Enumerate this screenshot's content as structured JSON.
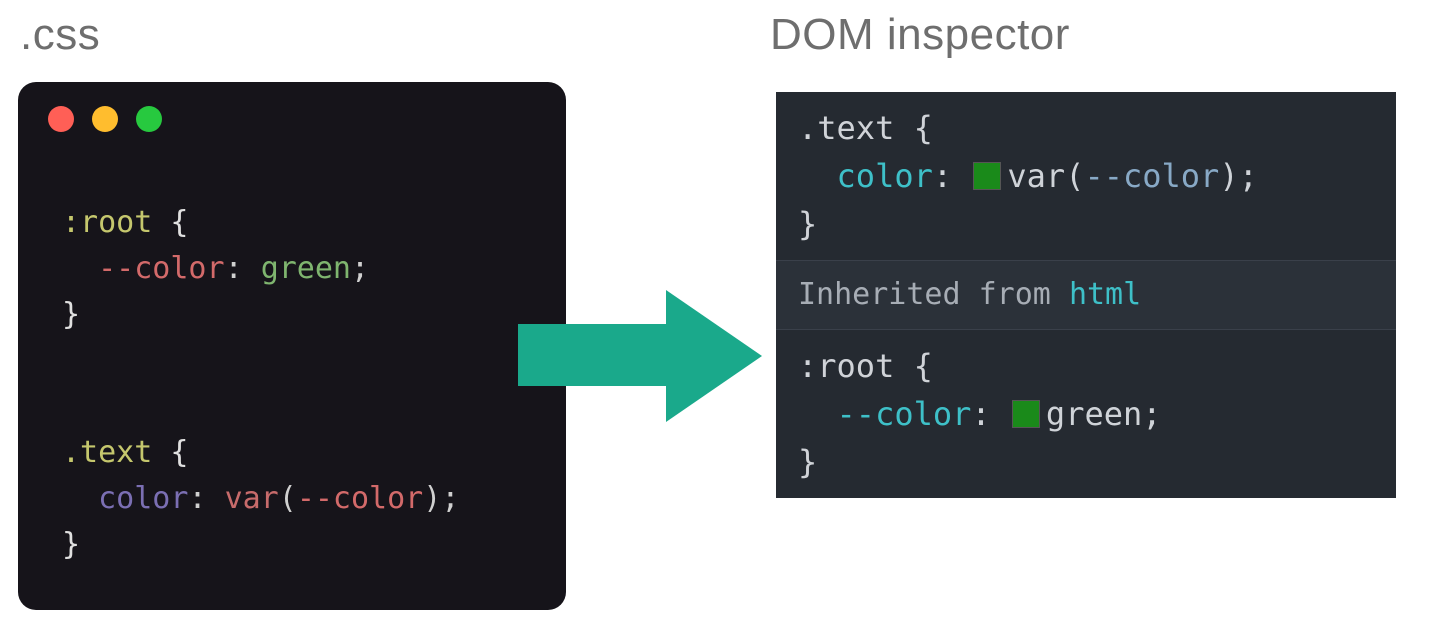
{
  "headings": {
    "left": ".css",
    "right": "DOM inspector"
  },
  "editor": {
    "rule1_selector": ":root",
    "rule1_prop": "--color",
    "rule1_value": "green",
    "rule2_selector": ".text",
    "rule2_prop": "color",
    "rule2_func": "var",
    "rule2_arg": "--color"
  },
  "inspector": {
    "top_selector": ".text",
    "top_prop": "color",
    "top_func": "var",
    "top_arg": "--color",
    "inherited_label": "Inherited from",
    "inherited_from": "html",
    "bottom_selector": ":root",
    "bottom_prop": "--color",
    "bottom_value": "green",
    "swatch_color": "#1a8a1a"
  },
  "glyphs": {
    "open": "{",
    "close": "}",
    "colon": ":",
    "semi": ";",
    "lpar": "(",
    "rpar": ")"
  }
}
